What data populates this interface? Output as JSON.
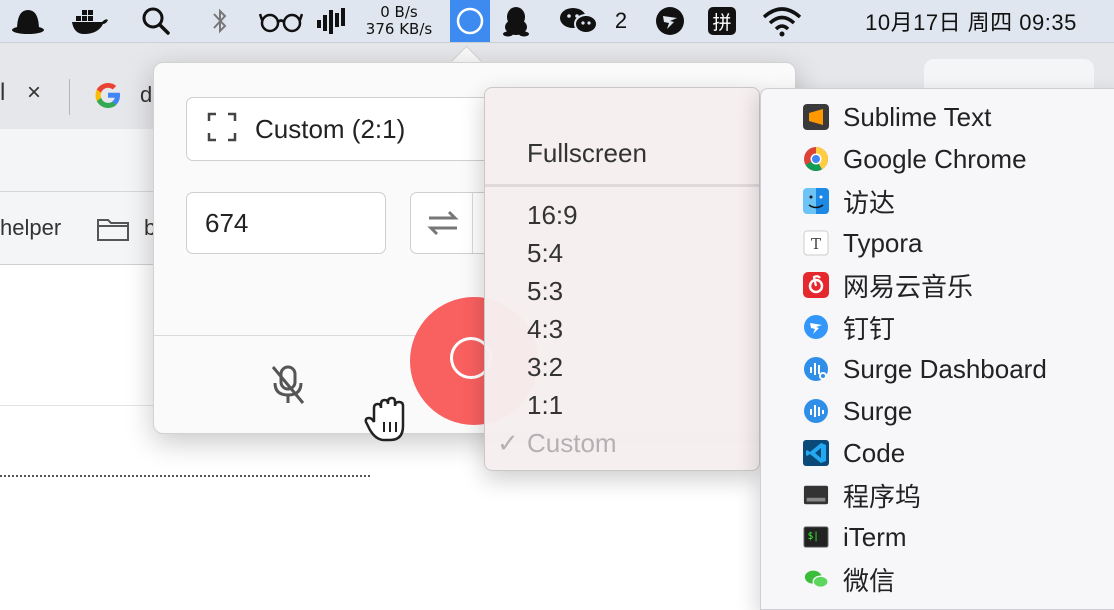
{
  "menubar": {
    "net_up": "0 B/s",
    "net_down": "376 KB/s",
    "wechat_count": "2",
    "input_method": "拼",
    "clock": "10月17日 周四 09:35"
  },
  "browser": {
    "tab_close": "×",
    "tab_title_partial": "d",
    "bookmark_helper": "helper",
    "bookmark_b": "b"
  },
  "recorder": {
    "aspect_value": "Custom (2:1)",
    "width_value": "674",
    "accent_color": "#f96060"
  },
  "aspect_menu": {
    "fullscreen": "Fullscreen",
    "options": [
      "16:9",
      "5:4",
      "5:3",
      "4:3",
      "3:2",
      "1:1"
    ],
    "custom": "Custom",
    "selected_mark": "✓"
  },
  "app_menu": {
    "apps": [
      {
        "name": "Sublime Text",
        "icon": "sublime-icon"
      },
      {
        "name": "Google Chrome",
        "icon": "chrome-icon"
      },
      {
        "name": "访达",
        "icon": "finder-icon"
      },
      {
        "name": "Typora",
        "icon": "typora-icon"
      },
      {
        "name": "网易云音乐",
        "icon": "netease-music-icon"
      },
      {
        "name": "钉钉",
        "icon": "dingtalk-icon"
      },
      {
        "name": "Surge Dashboard",
        "icon": "surge-dashboard-icon"
      },
      {
        "name": "Surge",
        "icon": "surge-icon"
      },
      {
        "name": "Code",
        "icon": "vscode-icon"
      },
      {
        "name": "程序坞",
        "icon": "dock-icon"
      },
      {
        "name": "iTerm",
        "icon": "iterm-icon"
      },
      {
        "name": "微信",
        "icon": "wechat-icon"
      }
    ]
  }
}
